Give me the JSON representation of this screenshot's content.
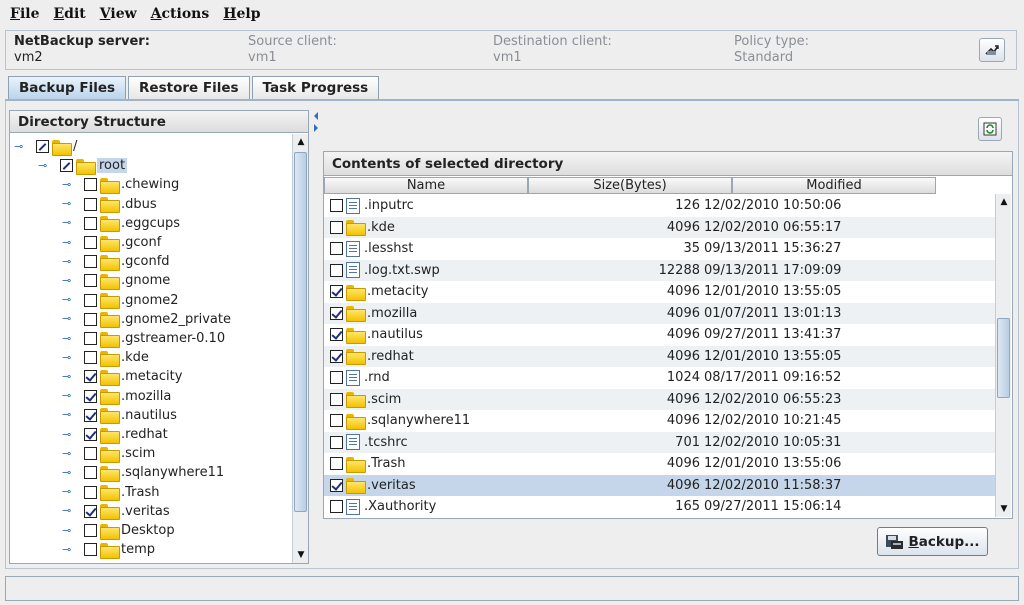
{
  "menu": [
    "File",
    "Edit",
    "View",
    "Actions",
    "Help"
  ],
  "info": {
    "server_label": "NetBackup server:",
    "server_value": "vm2",
    "source_label": "Source client:",
    "source_value": "vm1",
    "dest_label": "Destination client:",
    "dest_value": "vm1",
    "policy_label": "Policy type:",
    "policy_value": "Standard"
  },
  "tabs": [
    "Backup Files",
    "Restore Files",
    "Task Progress"
  ],
  "left_panel": {
    "title": "Directory Structure",
    "tree": [
      {
        "label": "/",
        "depth": 0,
        "state": "partial"
      },
      {
        "label": "root",
        "depth": 1,
        "state": "partial",
        "selected": true
      },
      {
        "label": ".chewing",
        "depth": 2,
        "state": "none"
      },
      {
        "label": ".dbus",
        "depth": 2,
        "state": "none"
      },
      {
        "label": ".eggcups",
        "depth": 2,
        "state": "none"
      },
      {
        "label": ".gconf",
        "depth": 2,
        "state": "none"
      },
      {
        "label": ".gconfd",
        "depth": 2,
        "state": "none"
      },
      {
        "label": ".gnome",
        "depth": 2,
        "state": "none"
      },
      {
        "label": ".gnome2",
        "depth": 2,
        "state": "none"
      },
      {
        "label": ".gnome2_private",
        "depth": 2,
        "state": "none"
      },
      {
        "label": ".gstreamer-0.10",
        "depth": 2,
        "state": "none"
      },
      {
        "label": ".kde",
        "depth": 2,
        "state": "none"
      },
      {
        "label": ".metacity",
        "depth": 2,
        "state": "checked"
      },
      {
        "label": ".mozilla",
        "depth": 2,
        "state": "checked"
      },
      {
        "label": ".nautilus",
        "depth": 2,
        "state": "checked"
      },
      {
        "label": ".redhat",
        "depth": 2,
        "state": "checked"
      },
      {
        "label": ".scim",
        "depth": 2,
        "state": "none"
      },
      {
        "label": ".sqlanywhere11",
        "depth": 2,
        "state": "none"
      },
      {
        "label": ".Trash",
        "depth": 2,
        "state": "none"
      },
      {
        "label": ".veritas",
        "depth": 2,
        "state": "checked"
      },
      {
        "label": "Desktop",
        "depth": 2,
        "state": "none"
      },
      {
        "label": "temp",
        "depth": 2,
        "state": "none"
      }
    ]
  },
  "right_panel": {
    "title": "Contents of selected directory",
    "columns": [
      "Name",
      "Size(Bytes)",
      "Modified"
    ],
    "rows": [
      {
        "name": ".inputrc",
        "type": "file",
        "checked": false,
        "size": "126",
        "modified": "12/02/2010 10:50:06"
      },
      {
        "name": ".kde",
        "type": "folder",
        "checked": false,
        "size": "4096",
        "modified": "12/02/2010 06:55:17"
      },
      {
        "name": ".lesshst",
        "type": "file",
        "checked": false,
        "size": "35",
        "modified": "09/13/2011 15:36:27"
      },
      {
        "name": ".log.txt.swp",
        "type": "file",
        "checked": false,
        "size": "12288",
        "modified": "09/13/2011 17:09:09"
      },
      {
        "name": ".metacity",
        "type": "folder",
        "checked": true,
        "size": "4096",
        "modified": "12/01/2010 13:55:05"
      },
      {
        "name": ".mozilla",
        "type": "folder",
        "checked": true,
        "size": "4096",
        "modified": "01/07/2011 13:01:13"
      },
      {
        "name": ".nautilus",
        "type": "folder",
        "checked": true,
        "size": "4096",
        "modified": "09/27/2011 13:41:37"
      },
      {
        "name": ".redhat",
        "type": "folder",
        "checked": true,
        "size": "4096",
        "modified": "12/01/2010 13:55:05"
      },
      {
        "name": ".rnd",
        "type": "file",
        "checked": false,
        "size": "1024",
        "modified": "08/17/2011 09:16:52"
      },
      {
        "name": ".scim",
        "type": "folder",
        "checked": false,
        "size": "4096",
        "modified": "12/02/2010 06:55:23"
      },
      {
        "name": ".sqlanywhere11",
        "type": "folder",
        "checked": false,
        "size": "4096",
        "modified": "12/02/2010 10:21:45"
      },
      {
        "name": ".tcshrc",
        "type": "file",
        "checked": false,
        "size": "701",
        "modified": "12/02/2010 10:05:31"
      },
      {
        "name": ".Trash",
        "type": "folder",
        "checked": false,
        "size": "4096",
        "modified": "12/01/2010 13:55:06"
      },
      {
        "name": ".veritas",
        "type": "folder",
        "checked": true,
        "size": "4096",
        "modified": "12/02/2010 11:58:37",
        "selected": true
      },
      {
        "name": ".Xauthority",
        "type": "file",
        "checked": false,
        "size": "165",
        "modified": "09/27/2011 15:06:14"
      }
    ]
  },
  "backup_button": {
    "underlined": "B",
    "rest": "ackup..."
  },
  "colors": {
    "accent": "#c5d6ea",
    "folder": "#f2c200",
    "tab_active": "#b8d2ea"
  }
}
